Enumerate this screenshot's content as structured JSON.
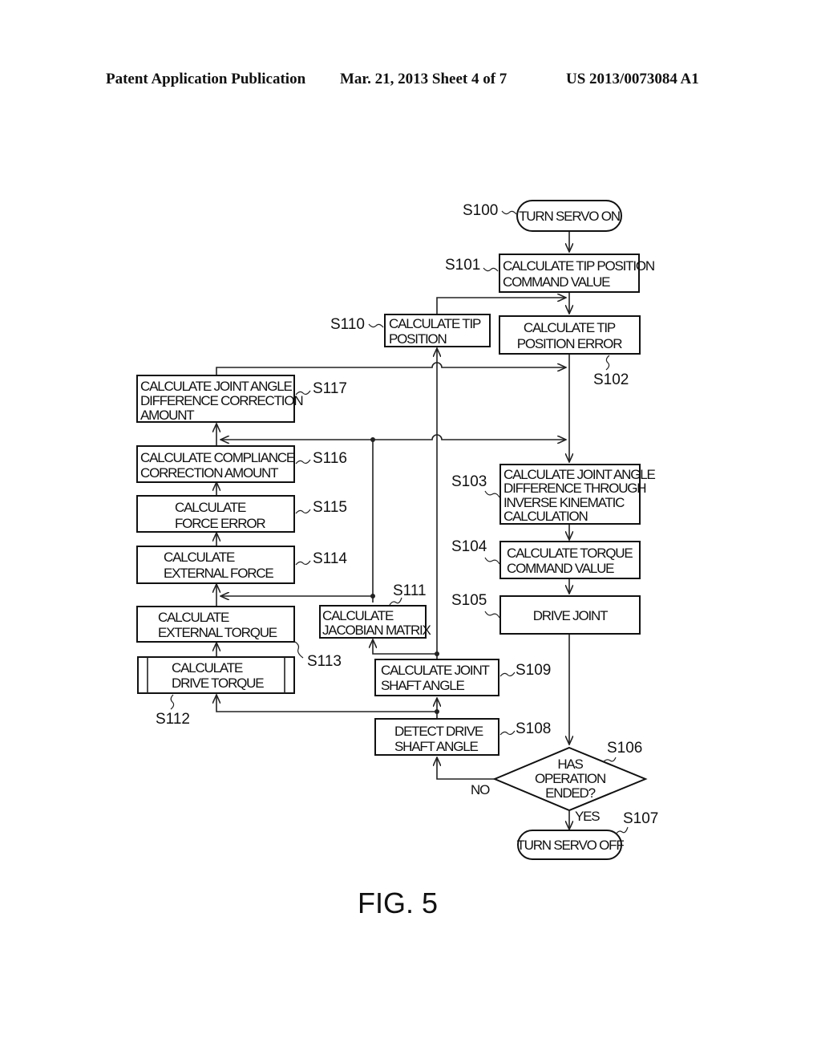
{
  "header": {
    "publication": "Patent Application Publication",
    "date_sheet": "Mar. 21, 2013  Sheet 4 of 7",
    "number": "US 2013/0073084 A1"
  },
  "figure_label": "FIG. 5",
  "steps": {
    "s100": {
      "id": "S100",
      "shape": "terminal",
      "lines": [
        "TURN SERVO ON"
      ]
    },
    "s101": {
      "id": "S101",
      "shape": "process",
      "lines": [
        "CALCULATE TIP POSITION",
        "COMMAND VALUE"
      ]
    },
    "s102": {
      "id": "S102",
      "shape": "process",
      "lines": [
        "CALCULATE TIP",
        "POSITION ERROR"
      ]
    },
    "s103": {
      "id": "S103",
      "shape": "process",
      "lines": [
        "CALCULATE JOINT ANGLE",
        "DIFFERENCE THROUGH",
        "INVERSE KINEMATIC",
        "CALCULATION"
      ]
    },
    "s104": {
      "id": "S104",
      "shape": "process",
      "lines": [
        "CALCULATE TORQUE",
        "COMMAND VALUE"
      ]
    },
    "s105": {
      "id": "S105",
      "shape": "process",
      "lines": [
        "DRIVE JOINT"
      ]
    },
    "s106": {
      "id": "S106",
      "shape": "decision",
      "lines": [
        "HAS",
        "OPERATION",
        "ENDED?"
      ],
      "yes_label": "YES",
      "no_label": "NO"
    },
    "s107": {
      "id": "S107",
      "shape": "terminal",
      "lines": [
        "TURN SERVO OFF"
      ]
    },
    "s108": {
      "id": "S108",
      "shape": "process",
      "lines": [
        "DETECT DRIVE",
        "SHAFT ANGLE"
      ]
    },
    "s109": {
      "id": "S109",
      "shape": "process",
      "lines": [
        "CALCULATE JOINT",
        "SHAFT ANGLE"
      ]
    },
    "s110": {
      "id": "S110",
      "shape": "process",
      "lines": [
        "CALCULATE TIP",
        "POSITION"
      ]
    },
    "s111": {
      "id": "S111",
      "shape": "process",
      "lines": [
        "CALCULATE",
        "JACOBIAN MATRIX"
      ]
    },
    "s112": {
      "id": "S112",
      "shape": "predefined-process",
      "lines": [
        "CALCULATE",
        "DRIVE TORQUE"
      ]
    },
    "s113": {
      "id": "S113",
      "shape": "process",
      "lines": [
        "CALCULATE",
        "EXTERNAL TORQUE"
      ]
    },
    "s114": {
      "id": "S114",
      "shape": "process",
      "lines": [
        "CALCULATE",
        "EXTERNAL FORCE"
      ]
    },
    "s115": {
      "id": "S115",
      "shape": "process",
      "lines": [
        "CALCULATE",
        "FORCE ERROR"
      ]
    },
    "s116": {
      "id": "S116",
      "shape": "process",
      "lines": [
        "CALCULATE COMPLIANCE",
        "CORRECTION AMOUNT"
      ]
    },
    "s117": {
      "id": "S117",
      "shape": "process",
      "lines": [
        "CALCULATE JOINT ANGLE",
        "DIFFERENCE CORRECTION",
        "AMOUNT"
      ]
    }
  }
}
